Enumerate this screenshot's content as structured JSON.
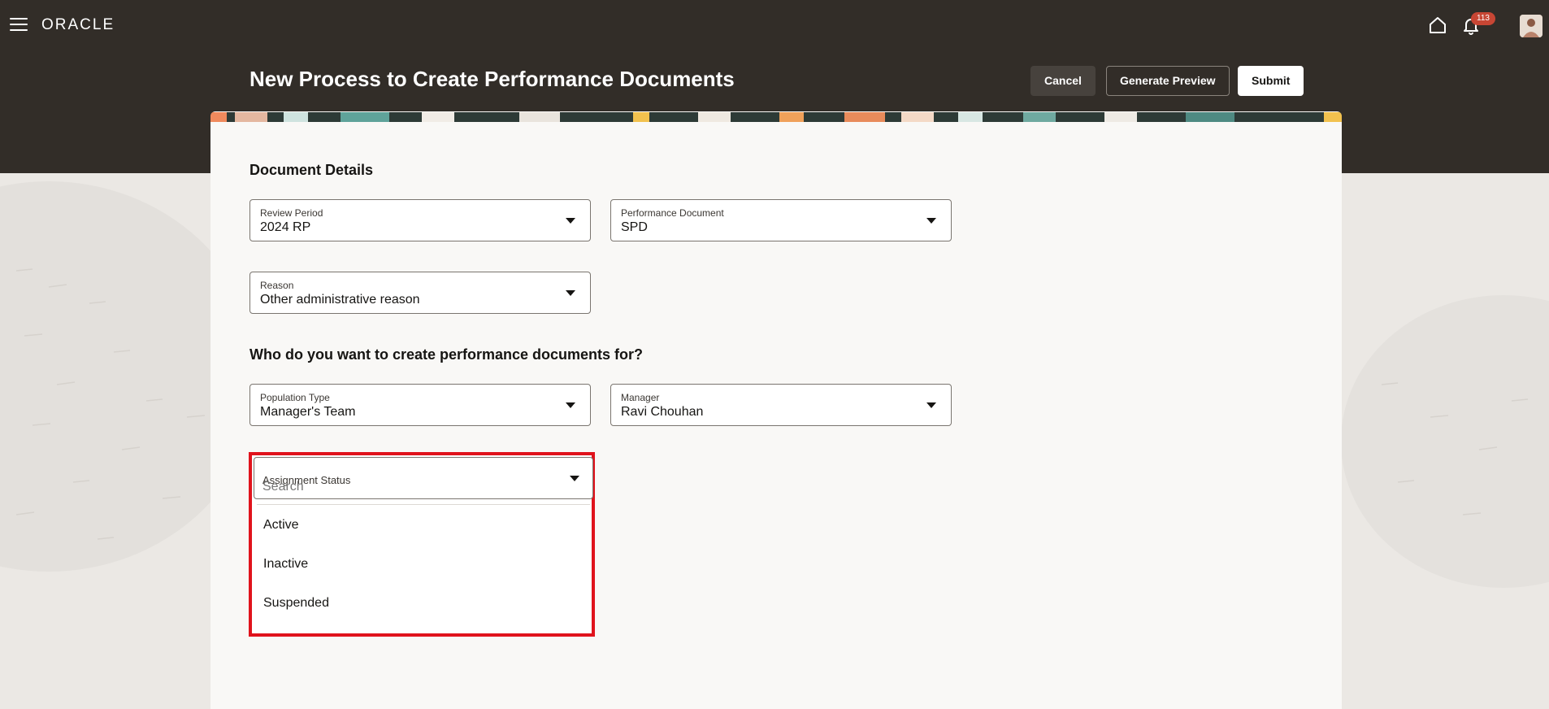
{
  "nav": {
    "logo": "ORACLE",
    "notification_count": "113"
  },
  "header": {
    "title": "New Process to Create Performance Documents",
    "cancel_label": "Cancel",
    "preview_label": "Generate Preview",
    "submit_label": "Submit"
  },
  "document_details": {
    "section_title": "Document Details",
    "review_period": {
      "label": "Review Period",
      "value": "2024 RP"
    },
    "performance_document": {
      "label": "Performance Document",
      "value": "SPD"
    },
    "reason": {
      "label": "Reason",
      "value": "Other administrative reason"
    }
  },
  "population": {
    "section_title": "Who do you want to create performance documents for?",
    "population_type": {
      "label": "Population Type",
      "value": "Manager's Team"
    },
    "manager": {
      "label": "Manager",
      "value": "Ravi Chouhan"
    },
    "assignment_status": {
      "label": "Assignment Status",
      "search_placeholder": "Search",
      "options": [
        "Active",
        "Inactive",
        "Suspended"
      ]
    }
  },
  "colors": {
    "header_bg": "#322d28",
    "highlight": "#e0131c",
    "badge": "#c74634"
  }
}
